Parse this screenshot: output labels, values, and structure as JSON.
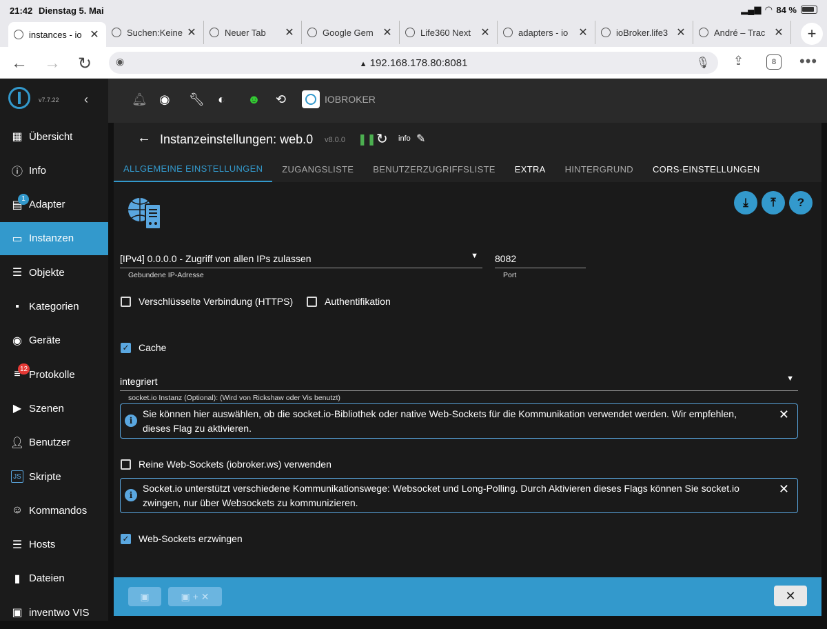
{
  "status": {
    "time": "21:42",
    "date": "Dienstag 5. Mai",
    "battery": "84 %"
  },
  "browser_tabs": [
    {
      "label": "instances - io",
      "active": true
    },
    {
      "label": "Suchen:Keine",
      "active": false
    },
    {
      "label": "Neuer Tab",
      "active": false
    },
    {
      "label": "Google Gem",
      "active": false
    },
    {
      "label": "Life360 Next",
      "active": false
    },
    {
      "label": "adapters - io",
      "active": false
    },
    {
      "label": "ioBroker.life3",
      "active": false
    },
    {
      "label": "André – Trac",
      "active": false
    }
  ],
  "url": "192.168.178.80:8081",
  "tab_count": "8",
  "sidebar": {
    "version": "v7.7.22",
    "items": [
      {
        "label": "Übersicht",
        "icon": "grid-icon"
      },
      {
        "label": "Info",
        "icon": "info-icon"
      },
      {
        "label": "Adapter",
        "icon": "store-icon",
        "badge": "1"
      },
      {
        "label": "Instanzen",
        "icon": "instances-icon",
        "active": true
      },
      {
        "label": "Objekte",
        "icon": "list-icon"
      },
      {
        "label": "Kategorien",
        "icon": "category-icon"
      },
      {
        "label": "Geräte",
        "icon": "device-icon"
      },
      {
        "label": "Protokolle",
        "icon": "log-icon",
        "badge": "12"
      },
      {
        "label": "Szenen",
        "icon": "scenes-icon"
      },
      {
        "label": "Benutzer",
        "icon": "user-icon"
      },
      {
        "label": "Skripte",
        "icon": "js-icon"
      },
      {
        "label": "Kommandos",
        "icon": "command-icon"
      },
      {
        "label": "Hosts",
        "icon": "hosts-icon"
      },
      {
        "label": "Dateien",
        "icon": "files-icon"
      },
      {
        "label": "inventwo VIS",
        "icon": "vis-icon"
      }
    ]
  },
  "topbar": {
    "brand": "IOBROKER"
  },
  "header": {
    "title": "Instanzeinstellungen: web.0",
    "version": "v8.0.0",
    "info": "info"
  },
  "settings_tabs": [
    {
      "label": "ALLGEMEINE EINSTELLUNGEN",
      "state": "active"
    },
    {
      "label": "ZUGANGSLISTE",
      "state": "normal"
    },
    {
      "label": "BENUTZERZUGRIFFSLISTE",
      "state": "normal"
    },
    {
      "label": "EXTRA",
      "state": "white"
    },
    {
      "label": "HINTERGRUND",
      "state": "normal"
    },
    {
      "label": "CORS-EINSTELLUNGEN",
      "state": "white"
    }
  ],
  "form": {
    "ip_value": "[IPv4] 0.0.0.0 - Zugriff von allen IPs zulassen",
    "ip_label": "Gebundene IP-Adresse",
    "port_value": "8082",
    "port_label": "Port",
    "https_label": "Verschlüsselte Verbindung (HTTPS)",
    "auth_label": "Authentifikation",
    "cache_label": "Cache",
    "socket_value": "integriert",
    "socket_label": "socket.io Instanz (Optional): (Wird von Rickshaw oder Vis benutzt)",
    "info1": "Sie können hier auswählen, ob die socket.io-Bibliothek oder native Web-Sockets für die Kommunikation verwendet werden. Wir empfehlen, dieses Flag zu aktivieren.",
    "pure_ws_label": "Reine Web-Sockets (iobroker.ws) verwenden",
    "info2": "Socket.io unterstützt verschiedene Kommunikationswege: Websocket und Long-Polling. Durch Aktivieren dieses Flags können Sie socket.io zwingen, nur über Websockets zu kommunizieren.",
    "force_ws_label": "Web-Sockets erzwingen"
  },
  "colors": {
    "accent": "#3399cc",
    "sidebar": "#1b1b1b",
    "background": "#1a1a1a"
  }
}
